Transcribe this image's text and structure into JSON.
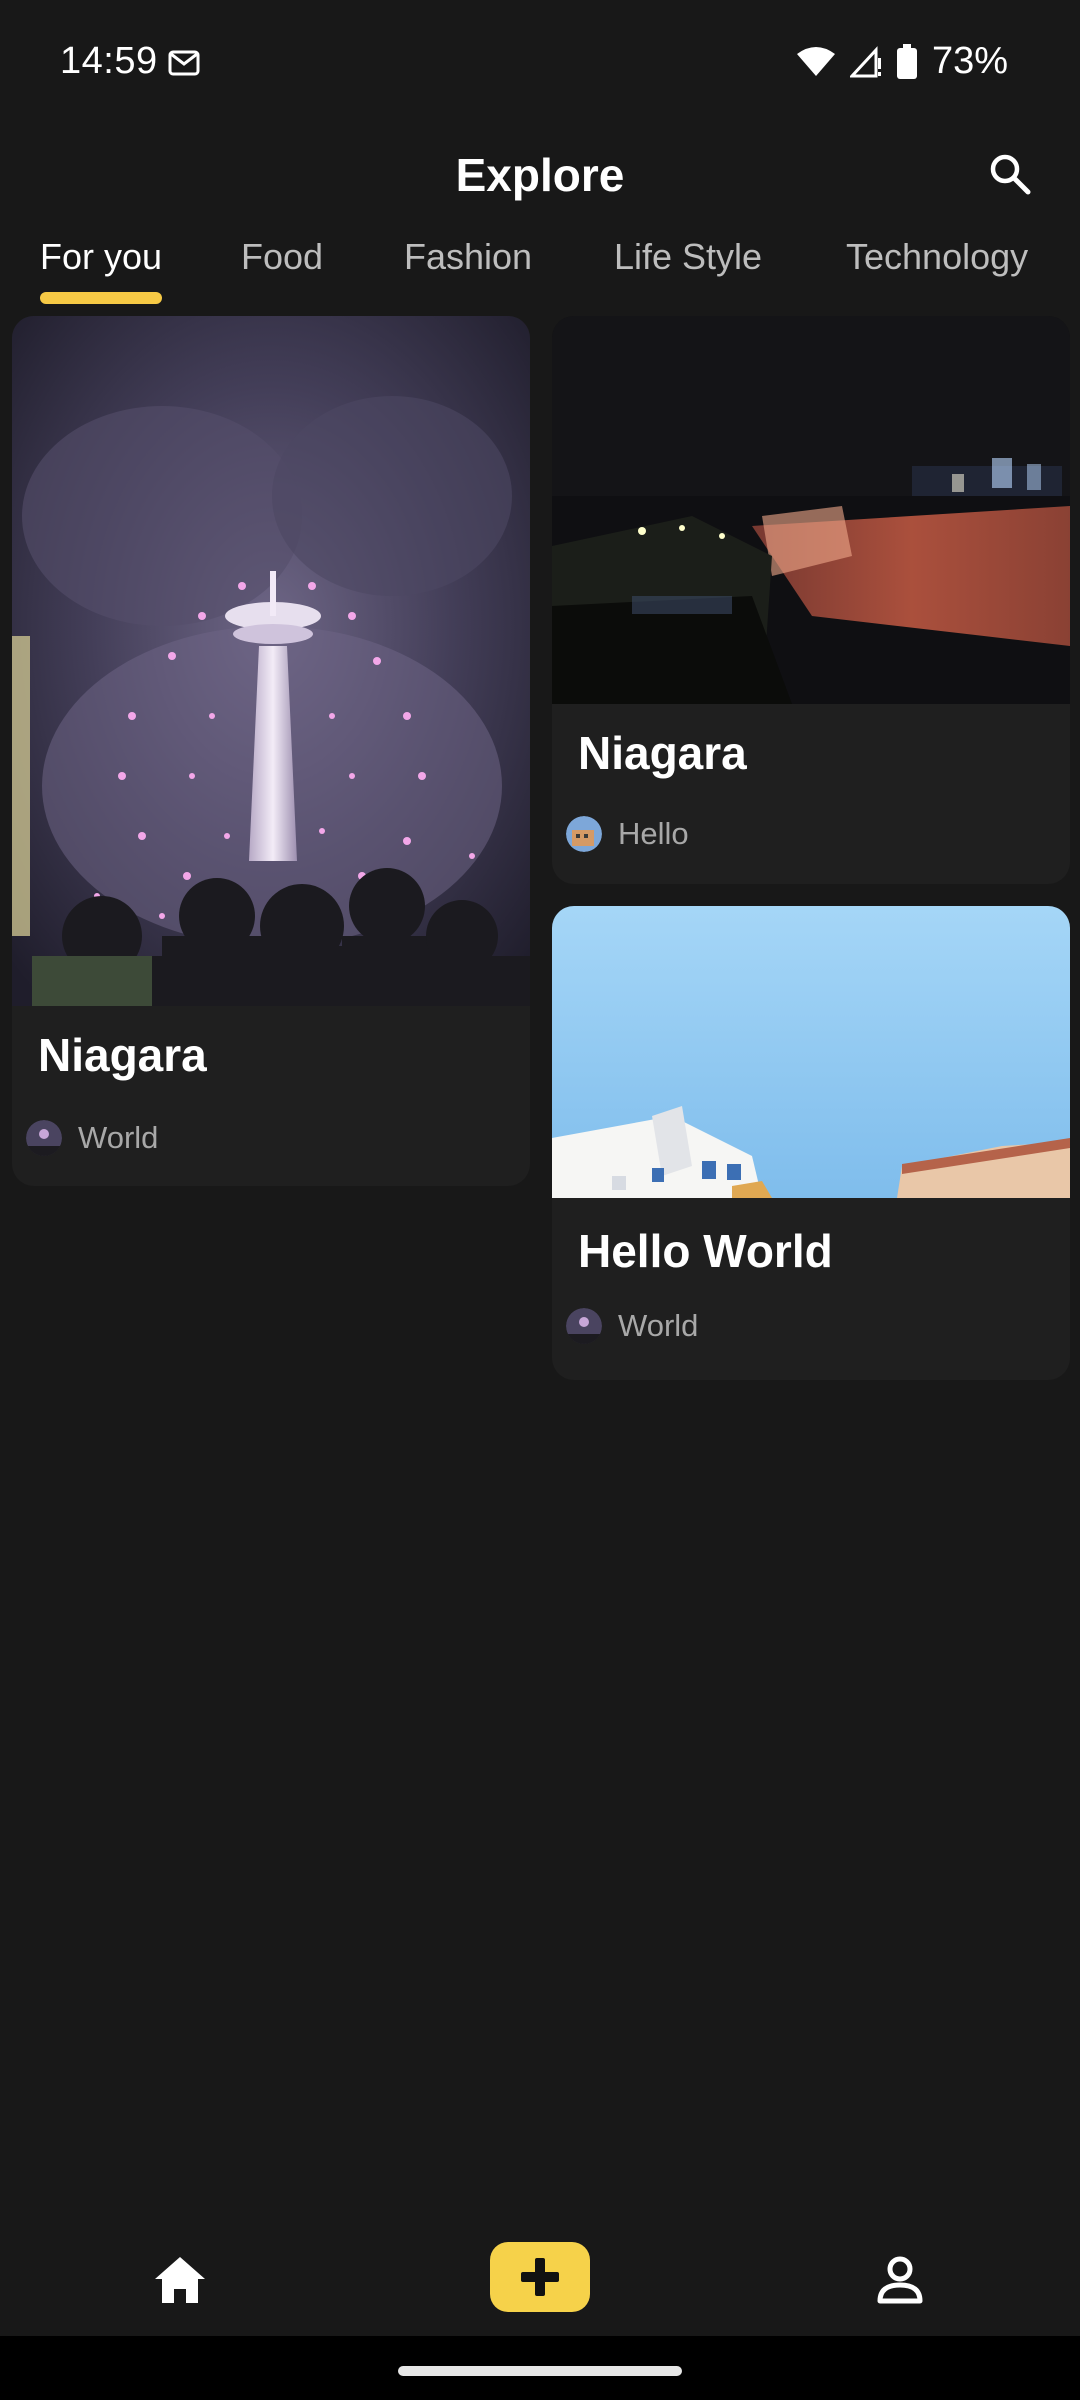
{
  "status_bar": {
    "time": "14:59",
    "battery": "73%"
  },
  "header": {
    "title": "Explore"
  },
  "tabs": [
    {
      "label": "For you",
      "active": true
    },
    {
      "label": "Food",
      "active": false
    },
    {
      "label": "Fashion",
      "active": false
    },
    {
      "label": "Life Style",
      "active": false
    },
    {
      "label": "Technology",
      "active": false
    }
  ],
  "cards": [
    {
      "title": "Niagara",
      "author": "World",
      "image": "fireworks-photo"
    },
    {
      "title": "Niagara",
      "author": "Hello",
      "image": "night-falls-photo"
    },
    {
      "title": "Hello World",
      "author": "World",
      "image": "sky-building-photo"
    }
  ],
  "bottom_nav": {
    "items": [
      "home-icon",
      "add-icon",
      "profile-icon"
    ]
  },
  "colors": {
    "background": "#181818",
    "card": "#1f1f1f",
    "accent": "#f6c945",
    "muted_text": "#a8a8a8"
  }
}
